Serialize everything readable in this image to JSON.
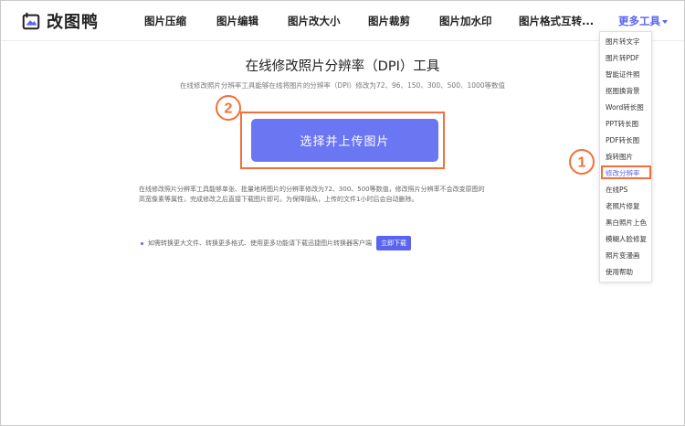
{
  "brand": {
    "name": "改图鸭"
  },
  "nav": {
    "items": [
      "图片压缩",
      "图片编辑",
      "图片改大小",
      "图片裁剪",
      "图片加水印",
      "图片格式互转..."
    ],
    "more_label": "更多工具"
  },
  "main": {
    "title": "在线修改照片分辨率（DPI）工具",
    "subtitle": "在线修改照片分辨率工具能够在线将图片的分辨率（DPI）修改为72、96、150、300、500、1000等数值",
    "upload_label": "选择并上传图片",
    "desc_line1": "在线修改照片分辨率工具能够单张、批量地将图片的分辨率修改为72、300、500等数值，修改照片分辨率不会改变原图的",
    "desc_line2": "高宽像素等属性，完成修改之后直接下载图片即可。为保障隐私，上传的文件1小时后会自动删除。",
    "tip_text": "如需转换更大文件、转换更多格式、使用更多功能请下载迅捷图片转换器客户端",
    "tip_button": "立即下载"
  },
  "dropdown": {
    "items": [
      "图片转文字",
      "图片转PDF",
      "智能证件照",
      "抠图换背景",
      "Word转长图",
      "PPT转长图",
      "PDF转长图",
      "旋转图片",
      "修改分辨率",
      "在线PS",
      "老照片修复",
      "黑白照片上色",
      "模糊人脸修复",
      "照片变漫画",
      "使用帮助"
    ],
    "active_index": 8
  },
  "annotations": {
    "step1": "①",
    "step2": "②"
  },
  "colors": {
    "accent": "#5b64f0",
    "upload_button": "#6b76f2",
    "annotation": "#f26f3a"
  }
}
